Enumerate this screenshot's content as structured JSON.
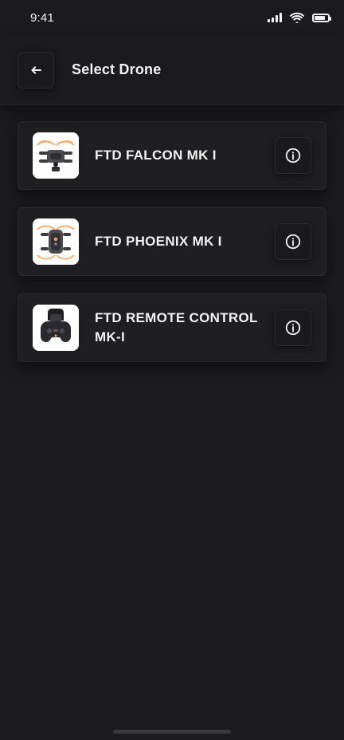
{
  "status_bar": {
    "time": "9:41",
    "icons": [
      "signal-bars-icon",
      "wifi-icon",
      "battery-icon"
    ]
  },
  "header": {
    "back_icon": "arrow-left-icon",
    "title": "Select Drone"
  },
  "drones": [
    {
      "name": "FTD FALCON MK I",
      "thumbnail_icon": "drone-falcon-icon",
      "info_icon": "info-icon"
    },
    {
      "name": "FTD PHOENIX MK I",
      "thumbnail_icon": "drone-phoenix-icon",
      "info_icon": "info-icon"
    },
    {
      "name": "FTD REMOTE CONTROL MK-I",
      "thumbnail_icon": "remote-controller-icon",
      "info_icon": "info-icon"
    }
  ],
  "colors": {
    "background": "#1b1b1d",
    "card": "#1f1f21",
    "text": "#f2f2f2",
    "accent_orange": "#f0a25a"
  }
}
